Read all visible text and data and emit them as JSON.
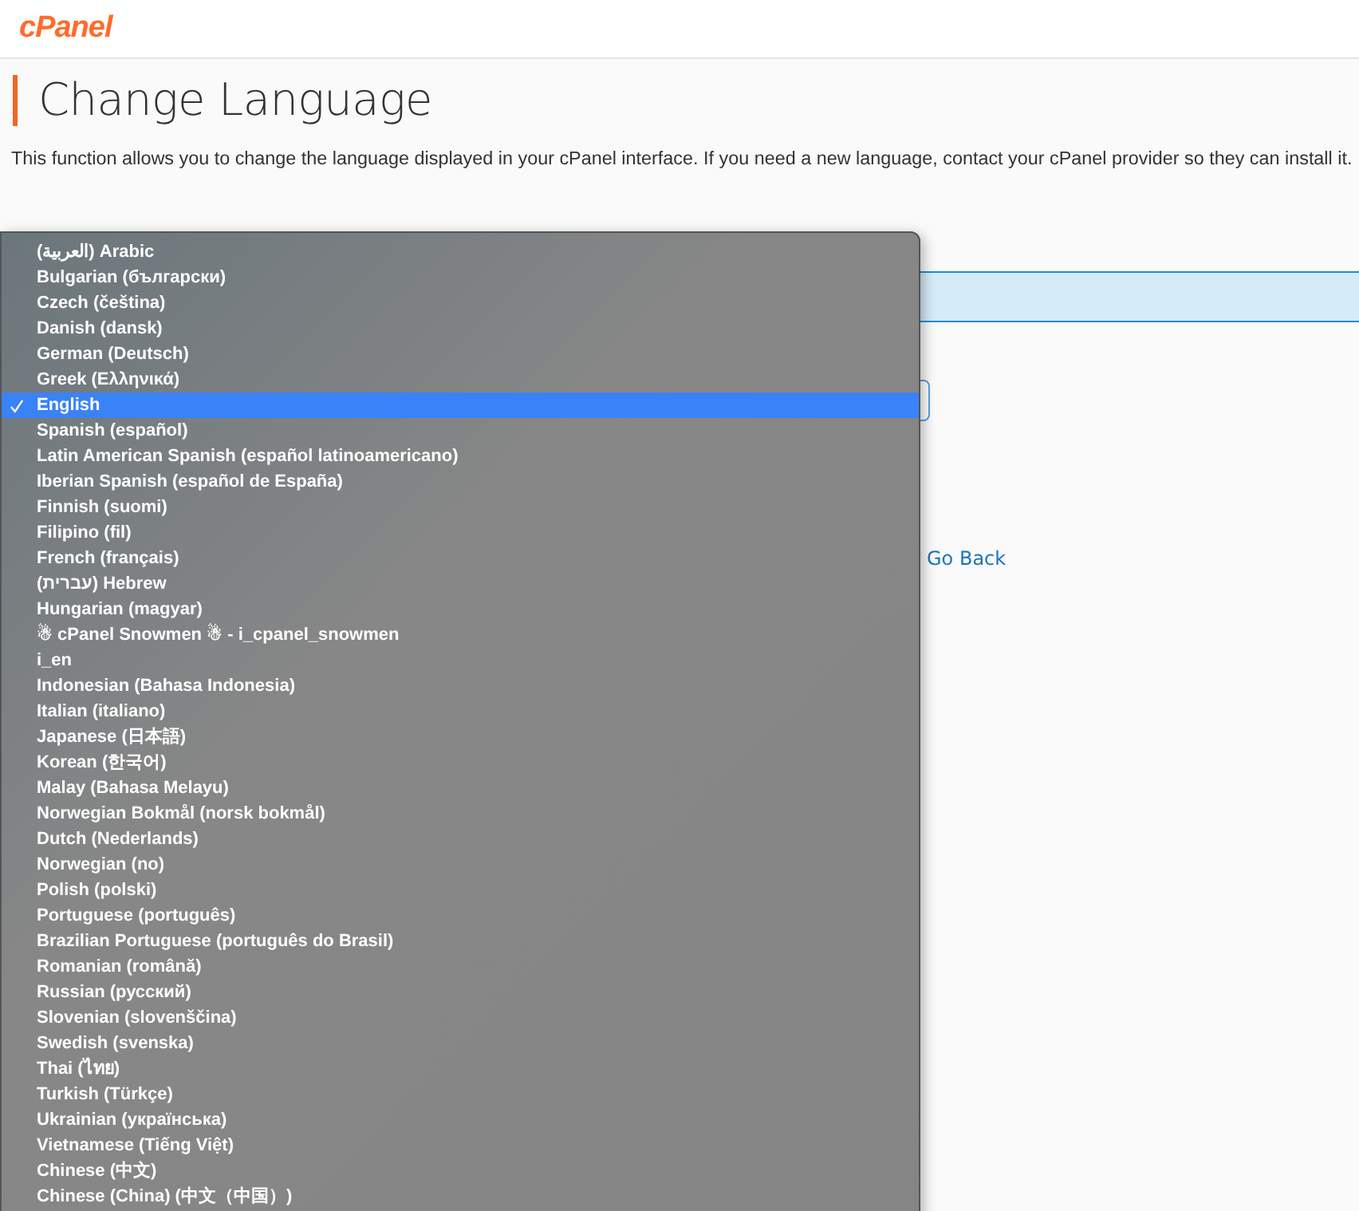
{
  "header": {
    "logo": "cPanel"
  },
  "page": {
    "title": "Change Language",
    "description": "This function allows you to change the language displayed in your cPanel interface. If you need a new language, contact your cPanel provider so they can install it.",
    "link": "Go Back"
  },
  "dropdown": {
    "options": [
      {
        "label": "(العربية) Arabic",
        "selected": false
      },
      {
        "label": "Bulgarian (български)",
        "selected": false
      },
      {
        "label": "Czech (čeština)",
        "selected": false
      },
      {
        "label": "Danish (dansk)",
        "selected": false
      },
      {
        "label": "German (Deutsch)",
        "selected": false
      },
      {
        "label": "Greek (Ελληνικά)",
        "selected": false
      },
      {
        "label": "English",
        "selected": true
      },
      {
        "label": "Spanish (español)",
        "selected": false
      },
      {
        "label": "Latin American Spanish (español latinoamericano)",
        "selected": false
      },
      {
        "label": "Iberian Spanish (español de España)",
        "selected": false
      },
      {
        "label": "Finnish (suomi)",
        "selected": false
      },
      {
        "label": "Filipino (fil)",
        "selected": false
      },
      {
        "label": "French (français)",
        "selected": false
      },
      {
        "label": "(עברית) Hebrew",
        "selected": false
      },
      {
        "label": "Hungarian (magyar)",
        "selected": false
      },
      {
        "label": "☃ cPanel Snowmen ☃ - i_cpanel_snowmen",
        "selected": false
      },
      {
        "label": "i_en",
        "selected": false
      },
      {
        "label": "Indonesian (Bahasa Indonesia)",
        "selected": false
      },
      {
        "label": "Italian (italiano)",
        "selected": false
      },
      {
        "label": "Japanese (日本語)",
        "selected": false
      },
      {
        "label": "Korean (한국어)",
        "selected": false
      },
      {
        "label": "Malay (Bahasa Melayu)",
        "selected": false
      },
      {
        "label": "Norwegian Bokmål (norsk bokmål)",
        "selected": false
      },
      {
        "label": "Dutch (Nederlands)",
        "selected": false
      },
      {
        "label": "Norwegian (no)",
        "selected": false
      },
      {
        "label": "Polish (polski)",
        "selected": false
      },
      {
        "label": "Portuguese (português)",
        "selected": false
      },
      {
        "label": "Brazilian Portuguese (português do Brasil)",
        "selected": false
      },
      {
        "label": "Romanian (română)",
        "selected": false
      },
      {
        "label": "Russian (русский)",
        "selected": false
      },
      {
        "label": "Slovenian (slovenščina)",
        "selected": false
      },
      {
        "label": "Swedish (svenska)",
        "selected": false
      },
      {
        "label": "Thai (ไทย)",
        "selected": false
      },
      {
        "label": "Turkish (Türkçe)",
        "selected": false
      },
      {
        "label": "Ukrainian (українська)",
        "selected": false
      },
      {
        "label": "Vietnamese (Tiếng Việt)",
        "selected": false
      },
      {
        "label": "Chinese (中文)",
        "selected": false
      },
      {
        "label": "Chinese (China) (中文（中国）)",
        "selected": false
      }
    ]
  }
}
